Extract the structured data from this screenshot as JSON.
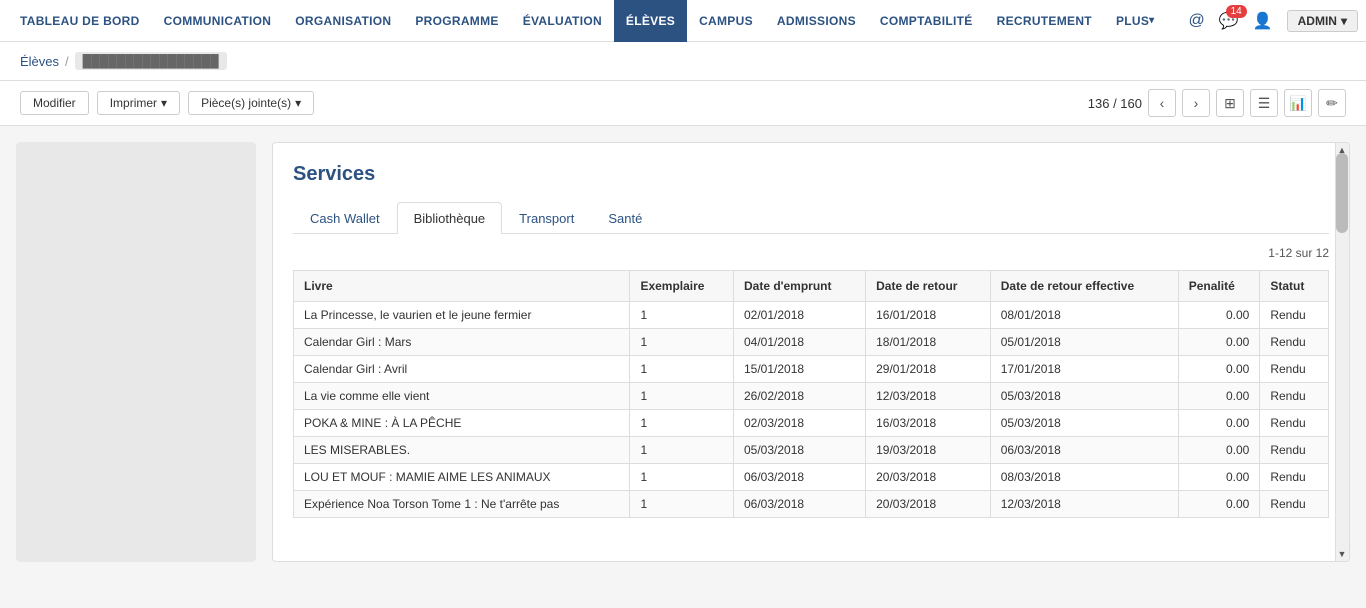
{
  "nav": {
    "items": [
      {
        "id": "tableau",
        "label": "TABLEAU DE BORD",
        "active": false
      },
      {
        "id": "communication",
        "label": "COMMUNICATION",
        "active": false
      },
      {
        "id": "organisation",
        "label": "ORGANISATION",
        "active": false
      },
      {
        "id": "programme",
        "label": "PROGRAMME",
        "active": false
      },
      {
        "id": "evaluation",
        "label": "ÉVALUATION",
        "active": false
      },
      {
        "id": "eleves",
        "label": "ÉLÈVES",
        "active": true
      },
      {
        "id": "campus",
        "label": "CAMPUS",
        "active": false
      },
      {
        "id": "admissions",
        "label": "ADMISSIONS",
        "active": false
      },
      {
        "id": "comptabilite",
        "label": "COMPTABILITÉ",
        "active": false
      },
      {
        "id": "recrutement",
        "label": "RECRUTEMENT",
        "active": false
      },
      {
        "id": "plus",
        "label": "PLUS",
        "active": false,
        "dropdown": true
      }
    ],
    "chat_count": "14",
    "admin_label": "ADMIN"
  },
  "breadcrumb": {
    "parent": "Élèves",
    "separator": "/",
    "current": "████████████████"
  },
  "toolbar": {
    "modifier_label": "Modifier",
    "imprimer_label": "Imprimer",
    "pieces_label": "Pièce(s) jointe(s)",
    "page_info": "136 / 160"
  },
  "services": {
    "title": "Services",
    "tabs": [
      {
        "id": "cash-wallet",
        "label": "Cash Wallet",
        "active": false
      },
      {
        "id": "bibliotheque",
        "label": "Bibliothèque",
        "active": true
      },
      {
        "id": "transport",
        "label": "Transport",
        "active": false
      },
      {
        "id": "sante",
        "label": "Santé",
        "active": false
      }
    ],
    "pagination": "1-12 sur 12",
    "table": {
      "columns": [
        {
          "id": "livre",
          "label": "Livre"
        },
        {
          "id": "exemplaire",
          "label": "Exemplaire"
        },
        {
          "id": "date_emprunt",
          "label": "Date d'emprunt"
        },
        {
          "id": "date_retour",
          "label": "Date de retour"
        },
        {
          "id": "date_retour_effective",
          "label": "Date de retour effective"
        },
        {
          "id": "penalite",
          "label": "Penalité"
        },
        {
          "id": "statut",
          "label": "Statut"
        }
      ],
      "rows": [
        {
          "livre": "La Princesse, le vaurien et le jeune fermier",
          "exemplaire": "1",
          "date_emprunt": "02/01/2018",
          "date_retour": "16/01/2018",
          "date_retour_effective": "08/01/2018",
          "penalite": "0.00",
          "statut": "Rendu"
        },
        {
          "livre": "Calendar Girl : Mars",
          "exemplaire": "1",
          "date_emprunt": "04/01/2018",
          "date_retour": "18/01/2018",
          "date_retour_effective": "05/01/2018",
          "penalite": "0.00",
          "statut": "Rendu"
        },
        {
          "livre": "Calendar Girl : Avril",
          "exemplaire": "1",
          "date_emprunt": "15/01/2018",
          "date_retour": "29/01/2018",
          "date_retour_effective": "17/01/2018",
          "penalite": "0.00",
          "statut": "Rendu"
        },
        {
          "livre": "La vie comme elle vient",
          "exemplaire": "1",
          "date_emprunt": "26/02/2018",
          "date_retour": "12/03/2018",
          "date_retour_effective": "05/03/2018",
          "penalite": "0.00",
          "statut": "Rendu"
        },
        {
          "livre": "POKA & MINE : À LA PÊCHE",
          "exemplaire": "1",
          "date_emprunt": "02/03/2018",
          "date_retour": "16/03/2018",
          "date_retour_effective": "05/03/2018",
          "penalite": "0.00",
          "statut": "Rendu"
        },
        {
          "livre": "LES MISERABLES.",
          "exemplaire": "1",
          "date_emprunt": "05/03/2018",
          "date_retour": "19/03/2018",
          "date_retour_effective": "06/03/2018",
          "penalite": "0.00",
          "statut": "Rendu"
        },
        {
          "livre": "LOU ET MOUF : MAMIE AIME LES ANIMAUX",
          "exemplaire": "1",
          "date_emprunt": "06/03/2018",
          "date_retour": "20/03/2018",
          "date_retour_effective": "08/03/2018",
          "penalite": "0.00",
          "statut": "Rendu"
        },
        {
          "livre": "Expérience Noa Torson Tome 1 : Ne t'arrête pas",
          "exemplaire": "1",
          "date_emprunt": "06/03/2018",
          "date_retour": "20/03/2018",
          "date_retour_effective": "12/03/2018",
          "penalite": "0.00",
          "statut": "Rendu"
        }
      ]
    }
  }
}
